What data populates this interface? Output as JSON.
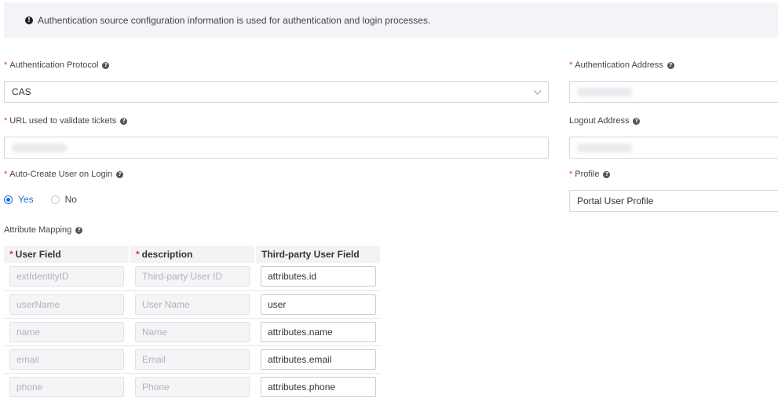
{
  "alert": {
    "text": "Authentication source configuration information is used for authentication and login processes."
  },
  "left": {
    "protocol": {
      "label": "Authentication Protocol",
      "value": "CAS"
    },
    "validate_url": {
      "label": "URL used to validate tickets"
    },
    "auto_create": {
      "label": "Auto-Create User on Login",
      "yes": "Yes",
      "no": "No",
      "selected": "Yes"
    },
    "mapping": {
      "label": "Attribute Mapping",
      "headers": [
        "User Field",
        "description",
        "Third-party User Field"
      ],
      "rows": [
        [
          "extIdentityID",
          "Third-party User ID",
          "attributes.id"
        ],
        [
          "userName",
          "User Name",
          "user"
        ],
        [
          "name",
          "Name",
          "attributes.name"
        ],
        [
          "email",
          "Email",
          "attributes.email"
        ],
        [
          "phone",
          "Phone",
          "attributes.phone"
        ]
      ]
    }
  },
  "right": {
    "auth_address": {
      "label": "Authentication Address"
    },
    "logout_address": {
      "label": "Logout Address"
    },
    "profile": {
      "label": "Profile",
      "value": "Portal User Profile"
    }
  },
  "colors": {
    "accent": "#1a6ede",
    "required": "#e53935"
  }
}
